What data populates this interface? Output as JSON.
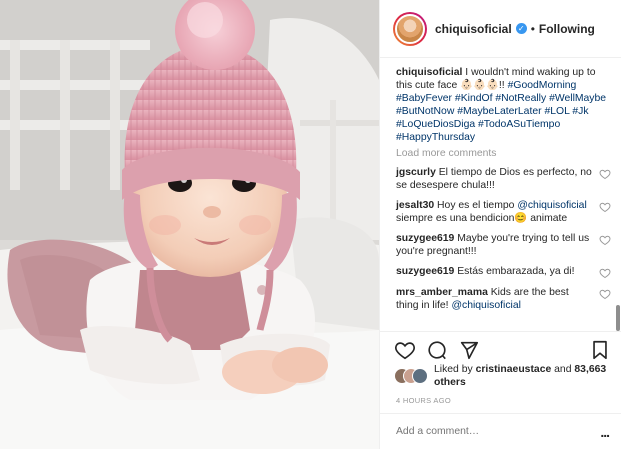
{
  "header": {
    "username": "chiquisoficial",
    "verified_icon": "verified-badge-icon",
    "separator": "•",
    "follow_status": "Following"
  },
  "caption": {
    "username": "chiquisoficial",
    "text": "I wouldn't mind waking up to this cute face 👶🏻👶🏻👶🏻!!",
    "hashtags": [
      "#GoodMorning",
      "#BabyFever",
      "#KindOf",
      "#NotReally",
      "#WellMaybe",
      "#ButNotNow",
      "#MaybeLaterLater",
      "#LOL",
      "#Jk",
      "#LoQueDiosDiga",
      "#TodoASuTiempo",
      "#HappyThursday"
    ]
  },
  "load_more": "Load more comments",
  "comments": [
    {
      "username": "jgscurly",
      "text": "El tiempo de Dios es perfecto, no se desespere chula!!!"
    },
    {
      "username": "jesalt30",
      "text": "Hoy es el tiempo",
      "mention": "@chiquisoficial",
      "text_after": "siempre es una bendicion😊 animate"
    },
    {
      "username": "suzygee619",
      "text": "Maybe you're trying to tell us you're pregnant!!!"
    },
    {
      "username": "suzygee619",
      "text": "Estás embarazada, ya di!"
    },
    {
      "username": "mrs_amber_mama",
      "text": "Kids are the best thing in life!",
      "mention": "@chiquisoficial"
    }
  ],
  "actions": {
    "like_icon": "heart-icon",
    "comment_icon": "comment-icon",
    "share_icon": "share-icon",
    "save_icon": "bookmark-icon"
  },
  "likes": {
    "prefix": "Liked by",
    "user": "cristinaeustace",
    "conjunction": "and",
    "count": "83,663 others"
  },
  "timestamp": "4 HOURS AGO",
  "add_comment": {
    "placeholder": "Add a comment…",
    "more": "..."
  },
  "colors": {
    "hashtag": "#003569",
    "verified": "#3897f0",
    "muted": "#999999",
    "border": "#efefef",
    "hat_pink": "#e8a9b6"
  }
}
